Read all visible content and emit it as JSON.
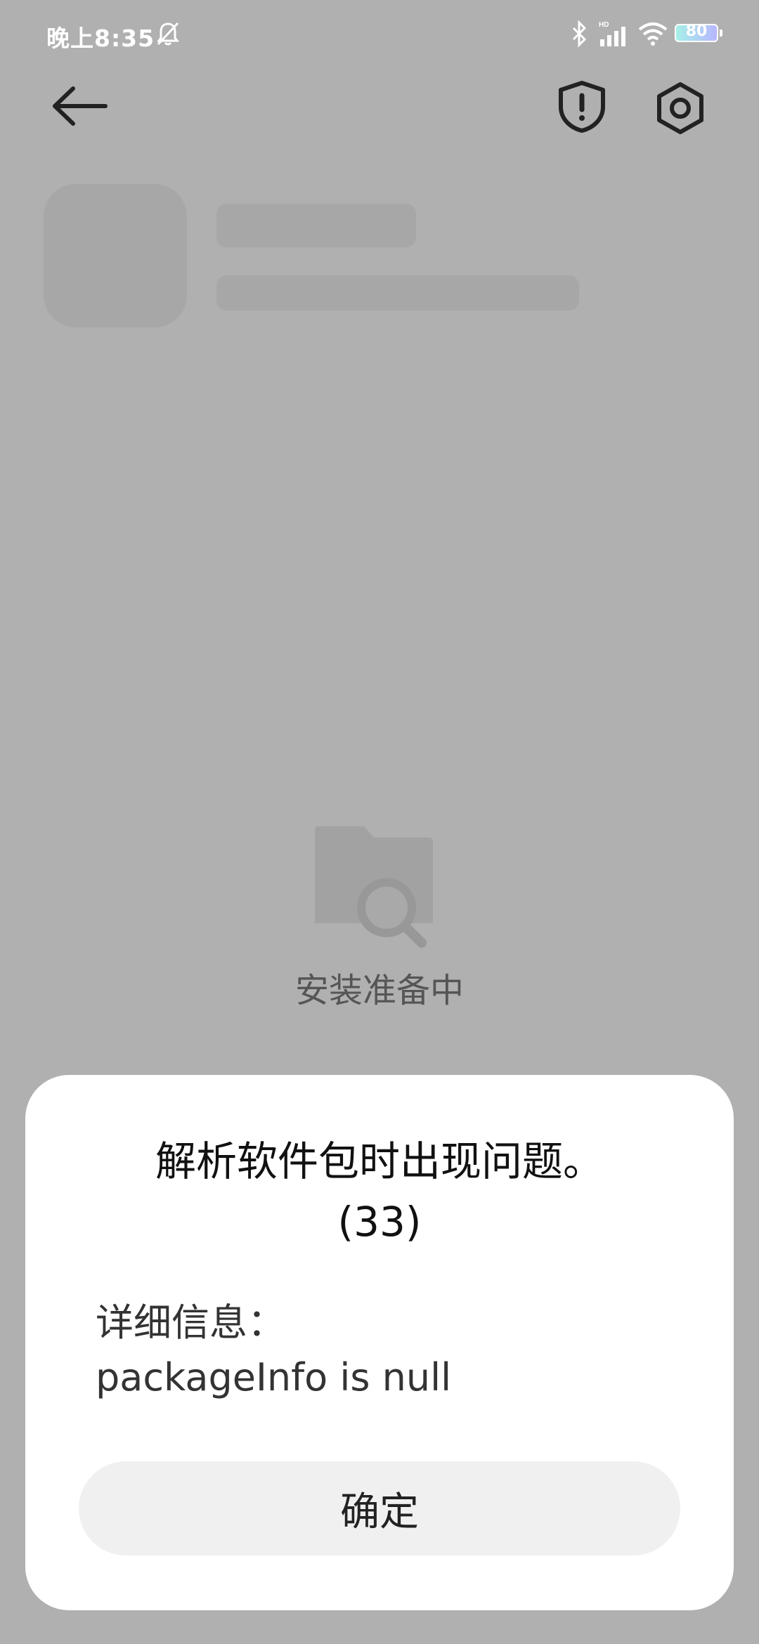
{
  "status_bar": {
    "time": "晚上8:35",
    "battery_level": "80",
    "icons": [
      "bell-muted-icon",
      "bluetooth-icon",
      "hd-signal-icon",
      "wifi-icon",
      "battery-icon"
    ]
  },
  "app_bar": {
    "icons": [
      "back-arrow-icon",
      "shield-alert-icon",
      "settings-icon"
    ]
  },
  "loading": {
    "icon": "folder-search-icon",
    "text": "安装准备中"
  },
  "dialog": {
    "title_line1": "解析软件包时出现问题。",
    "title_line2": "(33)",
    "detail_label": "详细信息：",
    "detail_value": "packageInfo is null",
    "ok_label": "确定"
  },
  "colors": {
    "scrim": "#b0b0b0",
    "skeleton": "#a7a7a7",
    "dialog_bg": "#ffffff",
    "button_bg": "#f0f0f0"
  }
}
